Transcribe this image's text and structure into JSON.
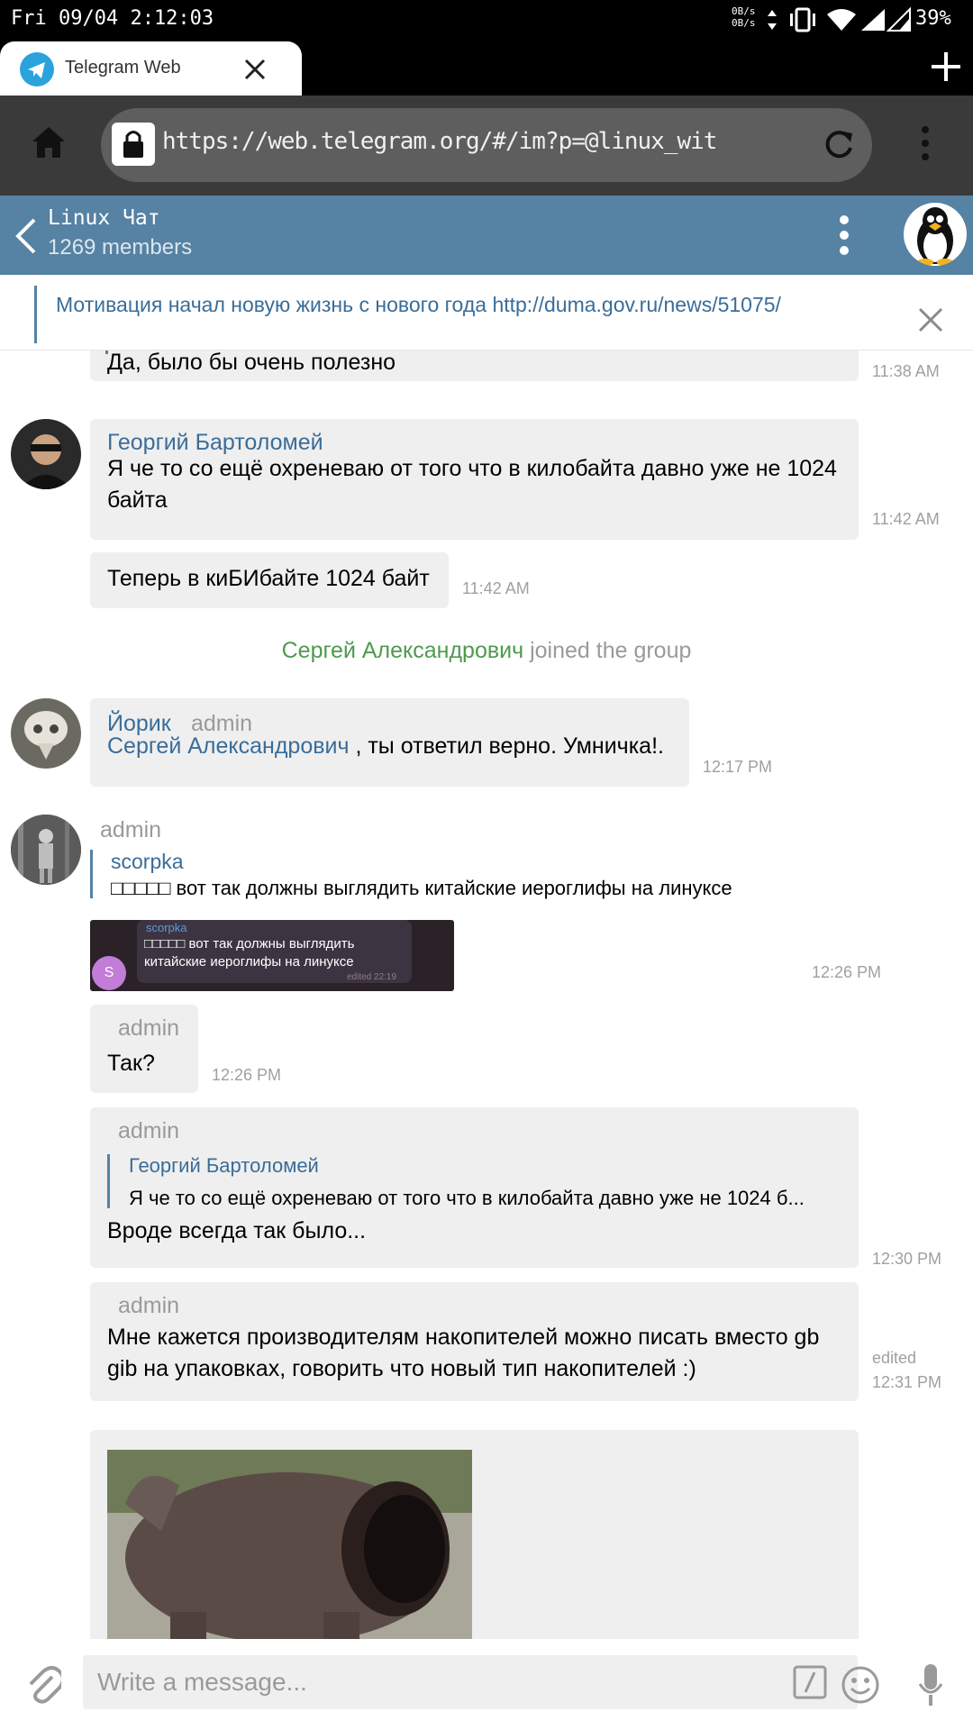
{
  "status_bar": {
    "datetime": "Fri 09/04 2:12:03",
    "net_up": "0B/s",
    "net_down": "0B/s",
    "battery": "39%"
  },
  "browser": {
    "tab_title": "Telegram Web",
    "url": "https://web.telegram.org/#/im?p=@linux_wit"
  },
  "chat": {
    "title": "Linux Чат",
    "members": "1269 members",
    "pinned_text": "Мотивация начал новую жизнь с нового года http://duma.gov.ru/news/51075/"
  },
  "messages": {
    "m1": {
      "text": "Да, было бы очень полезно",
      "time": "11:38 AM"
    },
    "m2": {
      "author": "Георгий Бартоломей",
      "text": "Я че то со ещё охреневаю от того что в килобайта давно уже не 1024 байта",
      "time": "11:42 AM"
    },
    "m3": {
      "text": "Теперь в киБИбайте 1024 байт",
      "time": "11:42 AM"
    },
    "service": {
      "user": "Сергей Александрович",
      "action": "joined the group"
    },
    "m4": {
      "author": "Йорик",
      "role": "admin",
      "mention": "Сергей Александрович",
      "text": " , ты ответил верно. Умничка!.",
      "time": "12:17 PM"
    },
    "m5": {
      "role": "admin",
      "reply_author": "scorpka",
      "reply_text": "□□□□□ вот так должны выглядить китайские иероглифы на линуксе",
      "img_author": "scorpka",
      "img_text": "□□□□□ вот так должны выглядить китайские иероглифы на линуксе",
      "img_edited": "edited 22:19",
      "img_avatar": "S",
      "time": "12:26 PM"
    },
    "m6": {
      "role": "admin",
      "text": "Так?",
      "time": "12:26 PM"
    },
    "m7": {
      "role": "admin",
      "reply_author": "Георгий Бартоломей",
      "reply_text": "Я че то со ещё охреневаю от того что в килобайта давно уже не 1024 б...",
      "text": "Вроде всегда так было...",
      "time": "12:30 PM"
    },
    "m8": {
      "role": "admin",
      "text": "Мне кажется производителям накопителей можно писать вместо gb gib на упаковках, говорить что новый тип накопителей :)",
      "edited": "edited",
      "time": "12:31 PM"
    }
  },
  "composer": {
    "placeholder": "Write a message..."
  },
  "colors": {
    "header_blue": "#5682a3",
    "link_blue": "#3a6d99",
    "service_green": "#4f9a4f",
    "bubble": "#efefef"
  },
  "icons": [
    "home-icon",
    "lock-icon",
    "reload-icon",
    "more-vert-icon",
    "plus-icon",
    "close-icon",
    "back-icon",
    "attach-icon",
    "command-icon",
    "emoji-icon",
    "mic-icon",
    "vibrate-icon",
    "wifi-icon",
    "signal-icon",
    "battery-icon",
    "telegram-icon"
  ]
}
